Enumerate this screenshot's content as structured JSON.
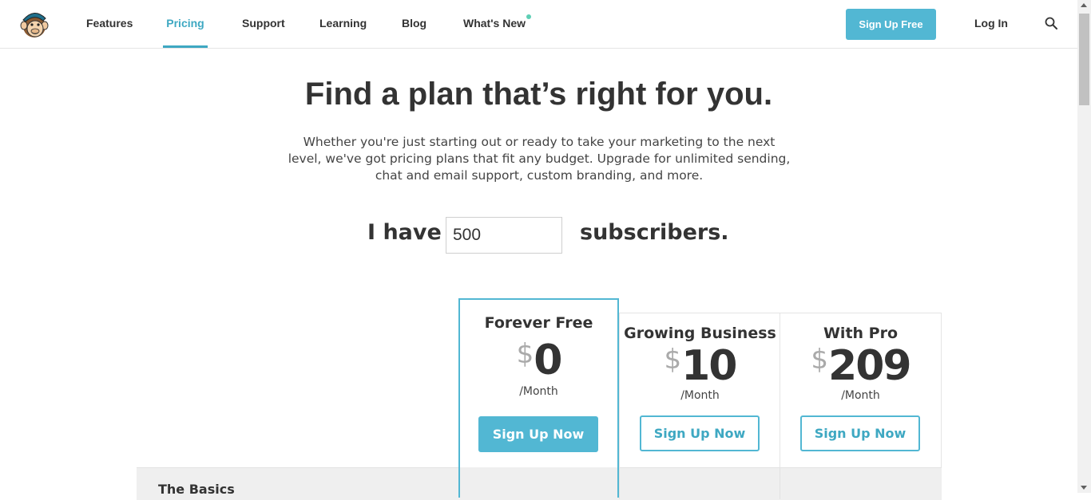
{
  "header": {
    "nav": [
      {
        "label": "Features",
        "active": false
      },
      {
        "label": "Pricing",
        "active": true
      },
      {
        "label": "Support",
        "active": false
      },
      {
        "label": "Learning",
        "active": false
      },
      {
        "label": "Blog",
        "active": false
      },
      {
        "label": "What's New",
        "active": false
      }
    ],
    "signup_label": "Sign Up Free",
    "login_label": "Log In",
    "accent_color": "#52b7d3",
    "new_dot_color": "#5ecfb5"
  },
  "hero": {
    "title": "Find a plan that’s right for you.",
    "text": "Whether you're just starting out or ready to take your marketing to the next level, we've got pricing plans that fit any budget. Upgrade for unlimited sending, chat and email support, custom branding, and more."
  },
  "subscribers": {
    "prefix": "I have",
    "value": "500",
    "suffix": "subscribers."
  },
  "plans": [
    {
      "name": "Forever Free",
      "currency": "$",
      "price": "0",
      "period": "/Month",
      "button": "Sign Up Now"
    },
    {
      "name": "Growing Business",
      "currency": "$",
      "price": "10",
      "period": "/Month",
      "button": "Sign Up Now"
    },
    {
      "name": "With Pro",
      "currency": "$",
      "price": "209",
      "period": "/Month",
      "button": "Sign Up Now"
    }
  ],
  "features": {
    "section_label": "The Basics"
  }
}
